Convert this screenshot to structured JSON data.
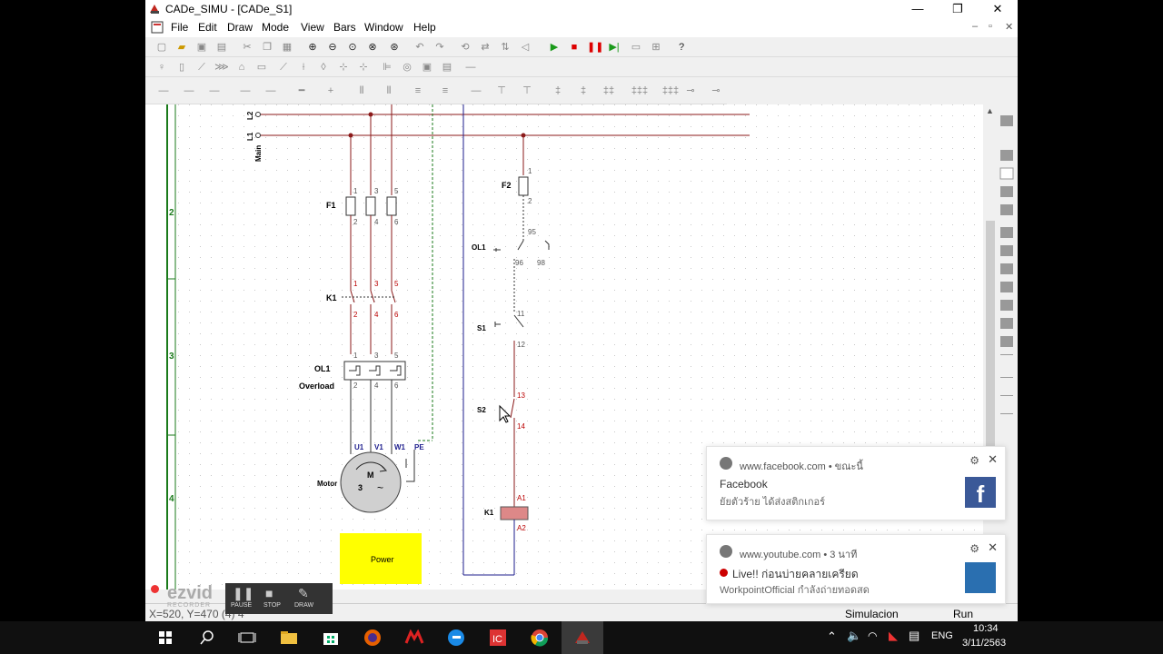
{
  "window": {
    "title": "CADe_SIMU - [CADe_S1]",
    "minimize": "—",
    "restore": "❐",
    "close": "✕"
  },
  "menu": [
    "File",
    "Edit",
    "Draw",
    "Mode",
    "View",
    "Bars",
    "Window",
    "Help"
  ],
  "mdi": {
    "min": "–",
    "restore": "▫",
    "close": "✕"
  },
  "ruler": [
    "2",
    "3",
    "4"
  ],
  "schematic": {
    "mains": [
      "L2",
      "L1",
      "Main"
    ],
    "f1": "F1",
    "k1": "K1",
    "ol1": "OL1",
    "overload": "Overload",
    "motor": "Motor",
    "motor_m": "M",
    "motor_3": "3",
    "motor_tilde": "~",
    "terms_top": [
      "1",
      "3",
      "5"
    ],
    "terms_bot": [
      "2",
      "4",
      "6"
    ],
    "u1": "U1",
    "v1": "V1",
    "w1": "W1",
    "pe": "PE",
    "power_btn": "Power",
    "f2": "F2",
    "f2_1": "1",
    "f2_2": "2",
    "ol1c": "OL1",
    "n95": "95",
    "n96": "96",
    "n98": "98",
    "s1": "S1",
    "n11": "11",
    "n12": "12",
    "s2": "S2",
    "n13": "13",
    "n14": "14",
    "k1c": "K1",
    "a1": "A1",
    "a2": "A2"
  },
  "status": {
    "coords": "X=520, Y=470 (4) 4",
    "mode": "Simulacion",
    "run": "Run"
  },
  "ezvid": {
    "logo": "ezvid",
    "sub": "RECORDER",
    "pause": "PAUSE",
    "stop": "STOP",
    "draw": "DRAW"
  },
  "notifications": [
    {
      "site": "www.facebook.com",
      "time": "• ขณะนี้",
      "title": "Facebook",
      "body": "ยัยตัวร้าย ได้ส่งสติกเกอร์"
    },
    {
      "site": "www.youtube.com",
      "time": "• 3 นาที",
      "title": "Live!! ก่อนบ่ายคลายเครียด",
      "body": "WorkpointOfficial กำลังถ่ายทอดสด"
    }
  ],
  "tray": {
    "lang": "ENG",
    "time": "10:34",
    "date": "3/11/2563"
  },
  "colors": {
    "phase": "#8b1a1a",
    "wire": "#222",
    "blue": "#1c1c8c",
    "power": "#ffff00",
    "ruler": "#1a7a1a"
  }
}
